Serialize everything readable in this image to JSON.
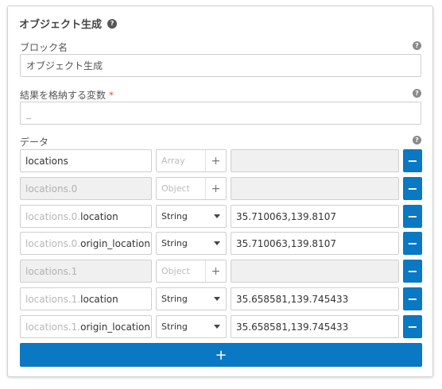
{
  "panel": {
    "title": "オブジェクト生成",
    "help_icon": "?"
  },
  "block_name": {
    "label": "ブロック名",
    "value": "オブジェクト生成"
  },
  "result_var": {
    "label": "結果を格納する変数",
    "required_mark": "*",
    "value": "_"
  },
  "data_section": {
    "label": "データ"
  },
  "rows": [
    {
      "prefix": "",
      "key": "locations",
      "type": "Array",
      "value": ""
    },
    {
      "prefix": "",
      "key": "locations.0",
      "type": "Object",
      "value": ""
    },
    {
      "prefix": "locations.0.",
      "key": "location",
      "type": "String",
      "value": "35.710063,139.8107"
    },
    {
      "prefix": "locations.0.",
      "key": "origin_location",
      "type": "String",
      "value": "35.710063,139.8107"
    },
    {
      "prefix": "",
      "key": "locations.1",
      "type": "Object",
      "value": ""
    },
    {
      "prefix": "locations.1.",
      "key": "location",
      "type": "String",
      "value": "35.658581,139.745433"
    },
    {
      "prefix": "locations.1.",
      "key": "origin_location",
      "type": "String",
      "value": "35.658581,139.745433"
    }
  ],
  "buttons": {
    "plus": "+",
    "minus": "−",
    "add_row": "+"
  },
  "colors": {
    "accent": "#0a78c2",
    "required": "#d9534f"
  }
}
